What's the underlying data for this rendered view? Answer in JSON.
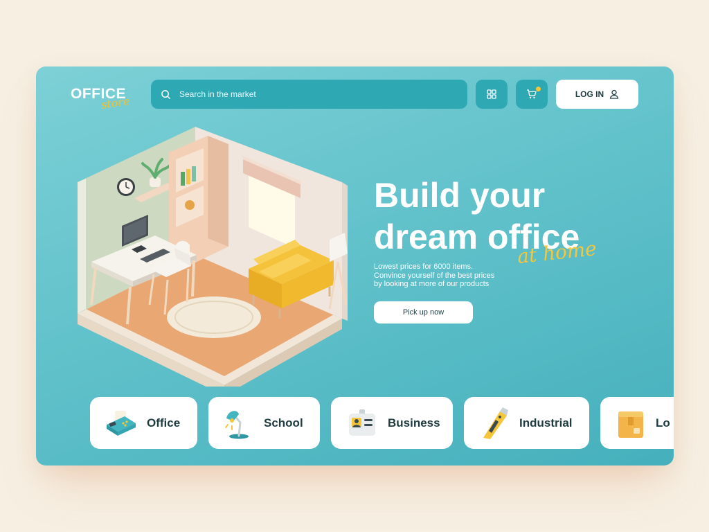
{
  "logo": {
    "main": "OFFICE",
    "script": "store"
  },
  "search": {
    "placeholder": "Search in the market"
  },
  "header": {
    "login_label": "LOG IN"
  },
  "hero": {
    "headline_line1": "Build your",
    "headline_line2": "dream office",
    "accent": "at home",
    "subtext": [
      "Lowest prices for 6000 items.",
      "Convince yourself of the best prices",
      "by looking at more of our products"
    ],
    "cta_label": "Pick up now"
  },
  "categories": [
    {
      "label": "Office",
      "icon": "fax-machine-icon"
    },
    {
      "label": "School",
      "icon": "desk-lamp-icon"
    },
    {
      "label": "Business",
      "icon": "id-badge-icon"
    },
    {
      "label": "Industrial",
      "icon": "utility-knife-icon"
    },
    {
      "label": "Lo",
      "icon": "package-box-icon"
    }
  ],
  "colors": {
    "background": "#f6efe2",
    "card": "#62c2cb",
    "accent_yellow": "#f5c63a",
    "dark_text": "#1e3b40"
  }
}
